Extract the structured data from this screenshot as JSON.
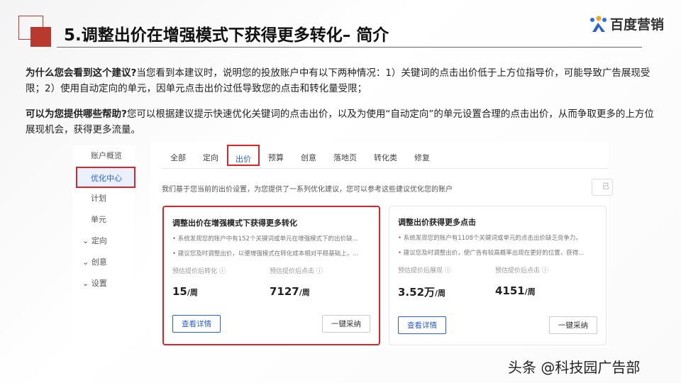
{
  "title": "5.调整出价在增强模式下获得更多转化– 简介",
  "logo": "百度营销",
  "para1": {
    "q": "为什么您会看到这个建议?",
    "a": "当您看到本建议时，说明您的投放账户中有以下两种情况：1）关键词的点击出价低于上方位指导价，可能导致广告展现受限；2）使用自动定向的单元，因单元点击出价过低导致您的点击和转化量受限；"
  },
  "para2": {
    "q": "可以为您提供哪些帮助?",
    "a": "您可以根据建议提示快速优化关键词的点击出价，以及为使用“自动定向”的单元设置合理的点击出价，从而争取更多的上方位展现机会，获得更多流量。"
  },
  "sidebar": [
    "账户概览",
    "优化中心",
    "计划",
    "单元",
    "定向",
    "创意",
    "设置"
  ],
  "tabs": [
    "全部",
    "定向",
    "出价",
    "预算",
    "创意",
    "落地页",
    "转化类",
    "修复"
  ],
  "note": "我们基于您当前的出价设置，为您提供了一系列优化建议，您可以参考这些建议优化您的账户",
  "exist": "已",
  "cards": [
    {
      "title": "调整出价在增强模式下获得更多转化",
      "b1": "• 系统发现您的账户中有152个关键词或单元在增强模式下的出价缺...",
      "b2": "• 建议您及时调整出价，以便增强模式在转化成本相对平稳基础上，...",
      "s1l": "预估提价后转化 ⓘ",
      "s1v": "15",
      "s2l": "预估提价后点击 ⓘ",
      "s2v": "7127",
      "unit": "/周",
      "btn1": "查看详情",
      "btn2": "一键采纳"
    },
    {
      "title": "调整出价获得更多点击",
      "b1": "• 系统发现您的账户有1108个关键词或单元的点击出价缺乏竞争力。",
      "b2": "• 建议您及时调整出价，使广告有较高概率出现在更好的位置，获得...",
      "s1l": "预估提价后展现 ⓘ",
      "s1v": "3.52万",
      "s2l": "预估提价后点击 ⓘ",
      "s2v": "4151",
      "unit": "/周",
      "btn1": "查看详情",
      "btn2": "一键采纳"
    }
  ],
  "watermark": "头条 @科技园广告部"
}
